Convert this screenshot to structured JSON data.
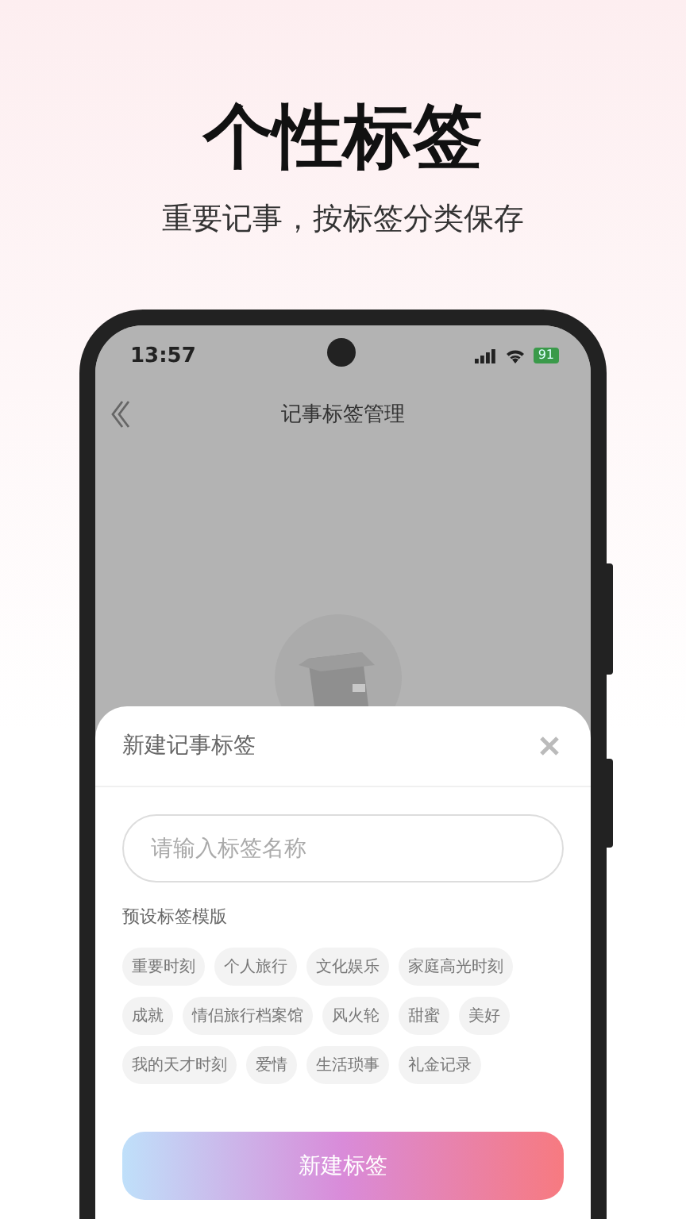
{
  "headline": "个性标签",
  "subtitle": "重要记事，按标签分类保存",
  "status_bar": {
    "time": "13:57",
    "battery": "91"
  },
  "nav": {
    "title": "记事标签管理"
  },
  "sheet": {
    "title": "新建记事标签",
    "input": {
      "placeholder": "请输入标签名称"
    },
    "section_label": "预设标签模版",
    "templates": [
      "重要时刻",
      "个人旅行",
      "文化娱乐",
      "家庭高光时刻",
      "成就",
      "情侣旅行档案馆",
      "风火轮",
      "甜蜜",
      "美好",
      "我的天才时刻",
      "爱情",
      "生活琐事",
      "礼金记录"
    ],
    "button": "新建标签"
  }
}
